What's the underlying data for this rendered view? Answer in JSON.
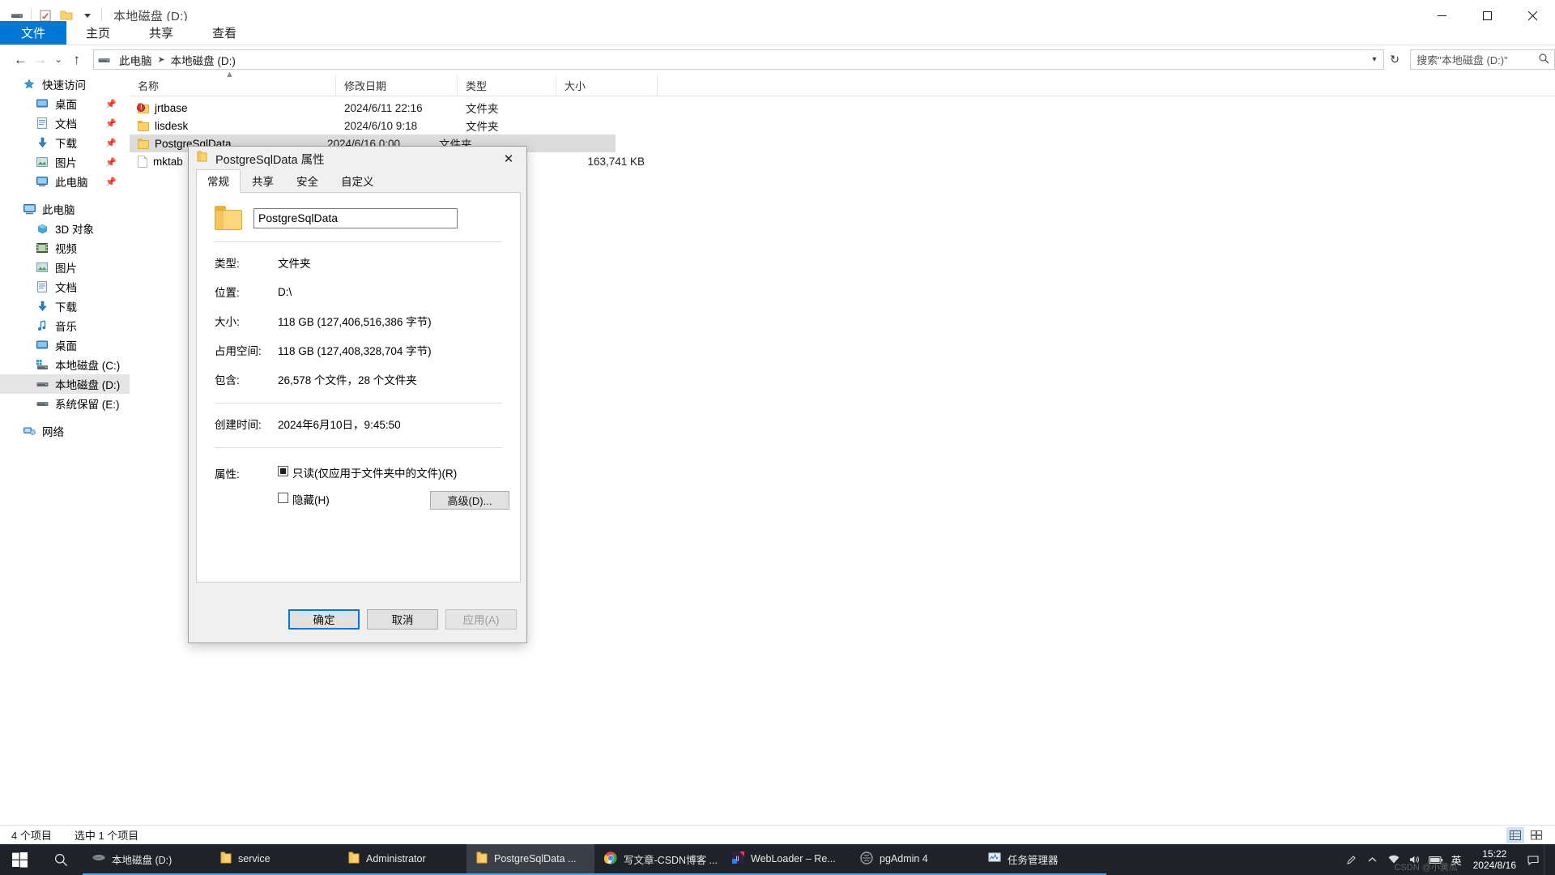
{
  "window": {
    "title": "本地磁盘 (D:)",
    "title_prefix": "",
    "qat_icons": [
      "drive-icon",
      "properties-icon",
      "new-folder-icon",
      "dropdown-icon"
    ],
    "buttons": {
      "minimize": "─",
      "maximize": "☐",
      "close": "✕",
      "help": "?"
    }
  },
  "ribbon": {
    "tabs": [
      {
        "label": "文件",
        "name": "tab-file"
      },
      {
        "label": "主页",
        "name": "tab-home"
      },
      {
        "label": "共享",
        "name": "tab-share"
      },
      {
        "label": "查看",
        "name": "tab-view"
      }
    ]
  },
  "nav": {
    "back": "←",
    "forward": "→",
    "recent": "⌄",
    "up": "↑",
    "breadcrumbs": [
      "此电脑",
      "本地磁盘 (D:)"
    ],
    "chevron": "⌄",
    "refresh": "↻",
    "search_placeholder": "搜索\"本地磁盘 (D:)\""
  },
  "sidebar": {
    "groups": [
      {
        "header": {
          "label": "快速访问",
          "icon": "star-icon",
          "name": "sidebar-item-quick-access"
        },
        "items": [
          {
            "label": "桌面",
            "icon": "desktop-icon",
            "pinned": true
          },
          {
            "label": "文档",
            "icon": "documents-icon",
            "pinned": true
          },
          {
            "label": "下载",
            "icon": "downloads-icon",
            "pinned": true
          },
          {
            "label": "图片",
            "icon": "pictures-icon",
            "pinned": true
          },
          {
            "label": "此电脑",
            "icon": "this-pc-icon",
            "pinned": true
          }
        ]
      },
      {
        "header": {
          "label": "此电脑",
          "icon": "this-pc-icon",
          "name": "sidebar-item-this-pc"
        },
        "items": [
          {
            "label": "3D 对象",
            "icon": "3d-objects-icon",
            "pinned": false
          },
          {
            "label": "视频",
            "icon": "videos-icon",
            "pinned": false
          },
          {
            "label": "图片",
            "icon": "pictures-icon",
            "pinned": false
          },
          {
            "label": "文档",
            "icon": "documents-icon",
            "pinned": false
          },
          {
            "label": "下载",
            "icon": "downloads-icon",
            "pinned": false
          },
          {
            "label": "音乐",
            "icon": "music-icon",
            "pinned": false
          },
          {
            "label": "桌面",
            "icon": "desktop-icon",
            "pinned": false
          },
          {
            "label": "本地磁盘 (C:)",
            "icon": "system-drive-icon",
            "pinned": false
          },
          {
            "label": "本地磁盘 (D:)",
            "icon": "drive-icon",
            "pinned": false,
            "selected": true
          },
          {
            "label": "系统保留 (E:)",
            "icon": "drive-icon",
            "pinned": false
          }
        ]
      },
      {
        "header": {
          "label": "网络",
          "icon": "network-icon",
          "name": "sidebar-item-network"
        },
        "items": []
      }
    ]
  },
  "filelist": {
    "columns": [
      {
        "label": "名称",
        "name": "column-name"
      },
      {
        "label": "修改日期",
        "name": "column-date"
      },
      {
        "label": "类型",
        "name": "column-type"
      },
      {
        "label": "大小",
        "name": "column-size"
      }
    ],
    "sort_indicator": "▲",
    "rows": [
      {
        "name": "jrtbase",
        "date": "2024/6/11 22:16",
        "type": "文件夹",
        "size": "",
        "icon": "folder-warning-icon",
        "selected": false
      },
      {
        "name": "lisdesk",
        "date": "2024/6/10 9:18",
        "type": "文件夹",
        "size": "",
        "icon": "folder-icon",
        "selected": false
      },
      {
        "name": "PostgreSqlData",
        "date": "2024/6/16 0:00",
        "type": "文件夹",
        "size": "",
        "icon": "folder-icon",
        "selected": true
      },
      {
        "name": "mktab",
        "date": "",
        "type": "",
        "size": "163,741 KB",
        "icon": "file-icon",
        "selected": false
      }
    ]
  },
  "statusbar": {
    "count": "4 个项目",
    "selection": "选中 1 个项目",
    "view_details": "details-view-icon",
    "view_tiles": "tiles-view-icon"
  },
  "dialog": {
    "title": "PostgreSqlData 属性",
    "icon": "folder-icon",
    "close": "✕",
    "tabs": [
      {
        "label": "常规",
        "active": true
      },
      {
        "label": "共享",
        "active": false
      },
      {
        "label": "安全",
        "active": false
      },
      {
        "label": "自定义",
        "active": false
      }
    ],
    "folder_name": "PostgreSqlData",
    "properties": [
      {
        "key": "类型:",
        "value": "文件夹"
      },
      {
        "key": "位置:",
        "value": "D:\\"
      },
      {
        "key": "大小:",
        "value": "118 GB (127,406,516,386 字节)"
      },
      {
        "key": "占用空间:",
        "value": "118 GB (127,408,328,704 字节)"
      },
      {
        "key": "包含:",
        "value": "26,578 个文件，28 个文件夹"
      }
    ],
    "created": {
      "key": "创建时间:",
      "value": "2024年6月10日，9:45:50"
    },
    "attributes": {
      "key": "属性:",
      "readonly_label": "只读(仅应用于文件夹中的文件)(R)",
      "readonly_state": "indeterminate",
      "hidden_label": "隐藏(H)",
      "hidden_state": "unchecked",
      "advanced_label": "高级(D)..."
    },
    "buttons": [
      {
        "label": "确定",
        "style": "default",
        "name": "ok-button"
      },
      {
        "label": "取消",
        "style": "normal",
        "name": "cancel-button"
      },
      {
        "label": "应用(A)",
        "style": "disabled",
        "name": "apply-button"
      }
    ]
  },
  "taskbar": {
    "start": "start-icon",
    "search": "search-icon",
    "apps": [
      {
        "label": "本地磁盘 (D:)",
        "icon": "drive-icon",
        "active": false,
        "open": true
      },
      {
        "label": "service",
        "icon": "folder-icon",
        "active": false,
        "open": true
      },
      {
        "label": "Administrator",
        "icon": "folder-icon",
        "active": false,
        "open": true
      },
      {
        "label": "PostgreSqlData ...",
        "icon": "folder-icon",
        "active": true,
        "open": true
      },
      {
        "label": "写文章-CSDN博客 ...",
        "icon": "chrome-icon",
        "active": false,
        "open": true
      },
      {
        "label": "WebLoader – Re...",
        "icon": "intellij-icon",
        "active": false,
        "open": true
      },
      {
        "label": "pgAdmin 4",
        "icon": "pgadmin-icon",
        "active": false,
        "open": true
      },
      {
        "label": "任务管理器",
        "icon": "task-manager-icon",
        "active": false,
        "open": true
      }
    ],
    "tray": [
      "pen-icon",
      "hidden-icons-icon",
      "network-icon",
      "volume-icon",
      "battery-icon"
    ],
    "ime": "英",
    "clock_time": "15:22",
    "clock_date": "2024/8/16",
    "watermark": "CSDN @小黄瓜"
  }
}
